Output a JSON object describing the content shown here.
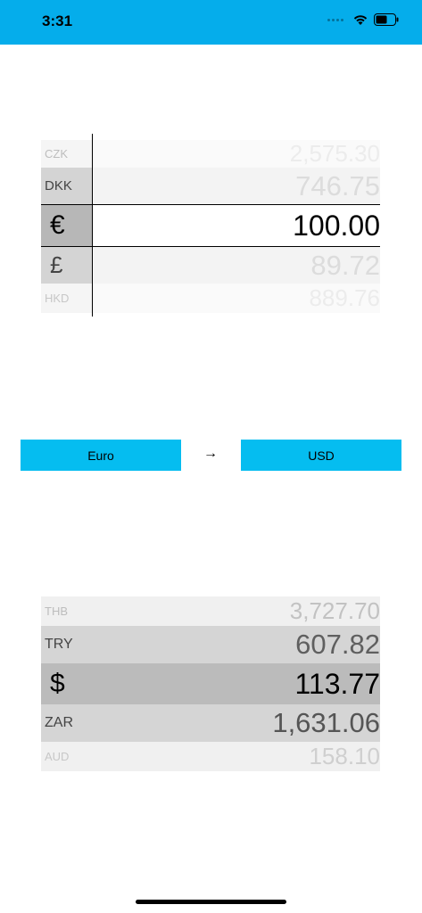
{
  "status_bar": {
    "time": "3:31",
    "background_color": "#05adeb",
    "icons": [
      "signal-icon",
      "wifi-icon",
      "battery-icon"
    ]
  },
  "from_picker": {
    "rows": [
      {
        "code": "CZK",
        "value": "2,575.30"
      },
      {
        "code": "DKK",
        "value": "746.75"
      },
      {
        "code": "€",
        "value": "100.00",
        "selected": true
      },
      {
        "code": "£",
        "value": "89.72"
      },
      {
        "code": "HKD",
        "value": "889.76"
      }
    ]
  },
  "selector": {
    "from_label": "Euro",
    "arrow": "→",
    "to_label": "USD",
    "button_color": "#05bdf0"
  },
  "to_picker": {
    "rows": [
      {
        "code": "THB",
        "value": "3,727.70"
      },
      {
        "code": "TRY",
        "value": "607.82"
      },
      {
        "code": "$",
        "value": "113.77",
        "selected": true
      },
      {
        "code": "ZAR",
        "value": "1,631.06"
      },
      {
        "code": "AUD",
        "value": "158.10"
      }
    ]
  }
}
